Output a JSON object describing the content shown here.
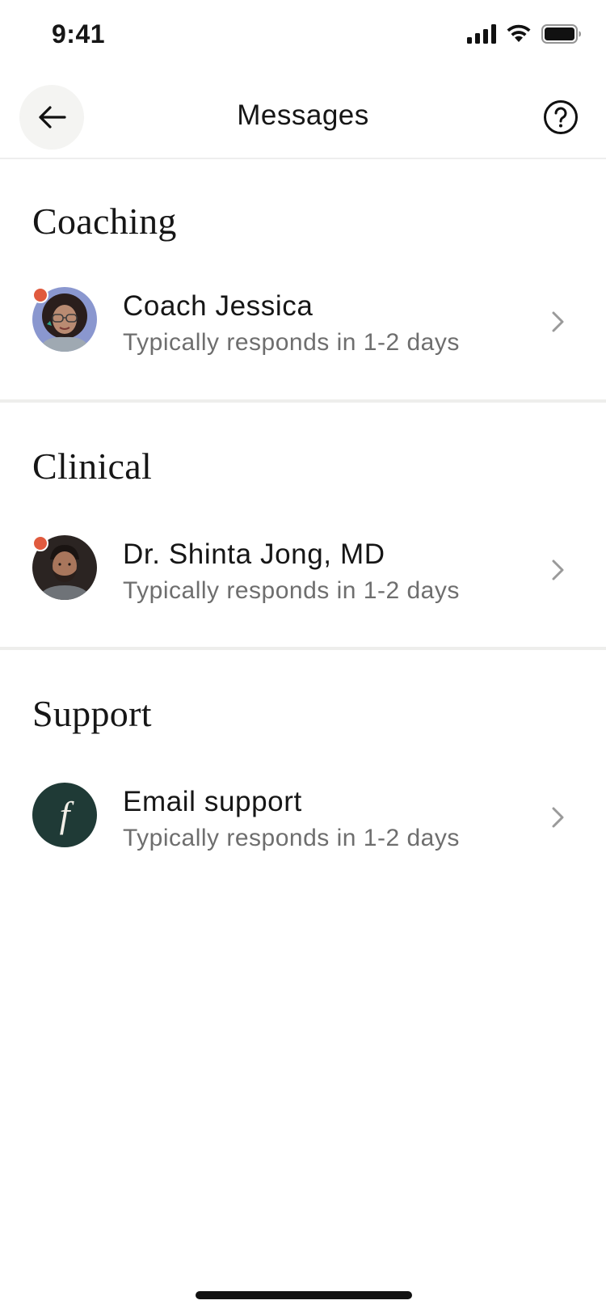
{
  "status_bar": {
    "time": "9:41"
  },
  "header": {
    "title": "Messages",
    "back_icon": "arrow-left-icon",
    "help_icon": "question-circle-icon"
  },
  "sections": [
    {
      "title": "Coaching",
      "contact": {
        "name": "Coach Jessica",
        "subtitle": "Typically responds in 1-2 days",
        "unread": true,
        "avatar": "coach-photo"
      }
    },
    {
      "title": "Clinical",
      "contact": {
        "name": "Dr. Shinta Jong, MD",
        "subtitle": "Typically responds in 1-2 days",
        "unread": true,
        "avatar": "doctor-photo"
      }
    },
    {
      "title": "Support",
      "contact": {
        "name": "Email support",
        "subtitle": "Typically responds in 1-2 days",
        "unread": false,
        "avatar": "brand-logo",
        "avatar_glyph": "f"
      }
    }
  ],
  "colors": {
    "unread_dot": "#e05a3e",
    "support_avatar_bg": "#1f3a36",
    "divider": "#eeeeec"
  }
}
